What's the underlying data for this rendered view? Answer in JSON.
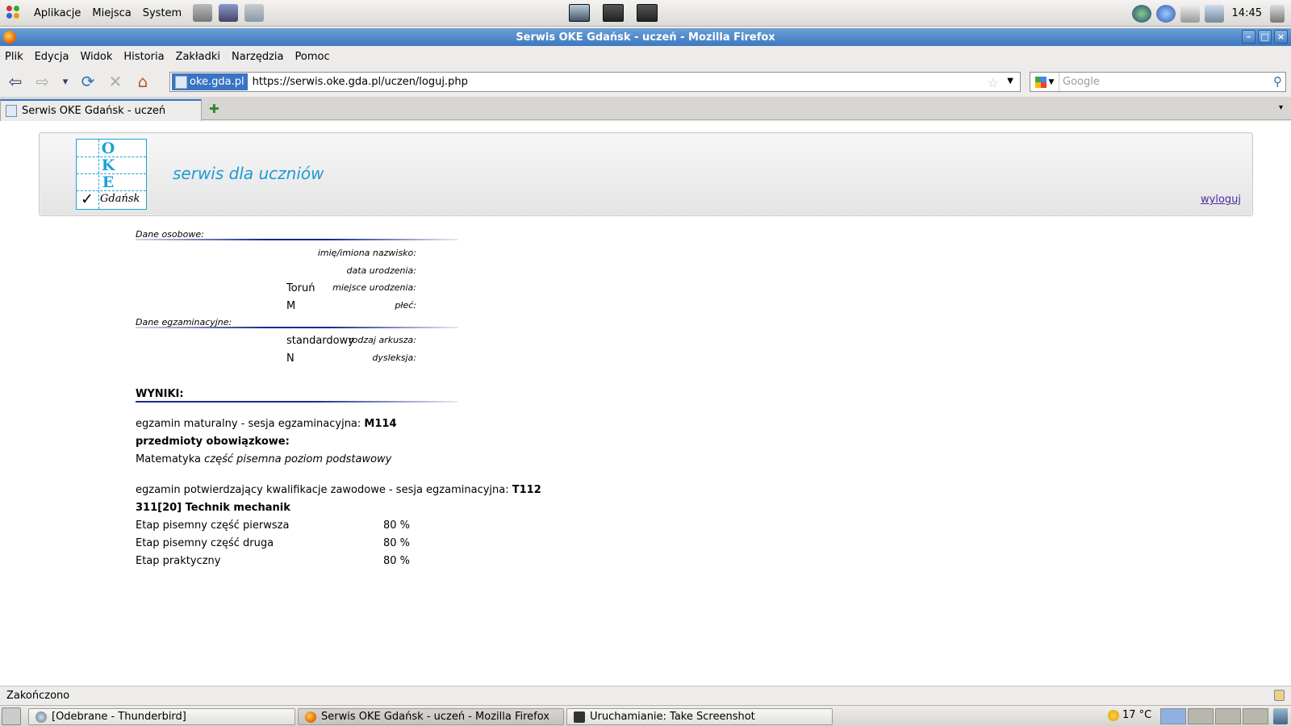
{
  "top_panel": {
    "menus": [
      "Aplikacje",
      "Miejsca",
      "System"
    ],
    "clock": "14:45"
  },
  "window": {
    "title": "Serwis OKE Gdańsk - uczeń - Mozilla Firefox",
    "min": "–",
    "max": "□",
    "close": "×"
  },
  "menubar": [
    "Plik",
    "Edycja",
    "Widok",
    "Historia",
    "Zakładki",
    "Narzędzia",
    "Pomoc"
  ],
  "navbar": {
    "back": "⇦",
    "forward": "⇨",
    "history": "▾",
    "reload": "⟳",
    "stop": "✕",
    "home": "⌂",
    "identity": "oke.gda.pl",
    "url": "https://serwis.oke.gda.pl/uczen/loguj.php",
    "search_placeholder": "Google"
  },
  "tab": {
    "title": "Serwis OKE Gdańsk - uczeń",
    "new_tab": "✚",
    "list": "▾"
  },
  "page": {
    "logo": {
      "letters": [
        "O",
        "K",
        "E"
      ],
      "check": "✓",
      "city": "Gdańsk"
    },
    "site_title": "serwis dla uczniów",
    "logout": "wyloguj",
    "personal": {
      "heading": "Dane osobowe:",
      "fields": [
        {
          "label": "imię/imiona nazwisko:",
          "value": ""
        },
        {
          "label": "data urodzenia:",
          "value": ""
        },
        {
          "label": "miejsce urodzenia:",
          "value": "Toruń"
        },
        {
          "label": "płeć:",
          "value": "M"
        }
      ]
    },
    "exam": {
      "heading": "Dane egzaminacyjne:",
      "fields": [
        {
          "label": "rodzaj arkusza:",
          "value": "standardowy"
        },
        {
          "label": "dysleksja:",
          "value": "N"
        }
      ]
    },
    "results": {
      "heading": "WYNIKI:",
      "matura_session_label": "egzamin maturalny - sesja egzaminacyjna: ",
      "matura_session": "M114",
      "mandatory": "przedmioty obowiązkowe:",
      "subject": "Matematyka",
      "subject_detail": "część pisemna poziom podstawowy",
      "vocational_label": "egzamin potwierdzający kwalifikacje zawodowe - sesja egzaminacyjna: ",
      "vocational_session": "T112",
      "profession": "311[20] Technik mechanik",
      "stages": [
        {
          "name": "Etap pisemny część pierwsza",
          "score": "80 %"
        },
        {
          "name": "Etap pisemny część druga",
          "score": "80 %"
        },
        {
          "name": "Etap praktyczny",
          "score": "80 %"
        }
      ]
    }
  },
  "status": {
    "text": "Zakończono"
  },
  "bottom_panel": {
    "tasks": [
      "[Odebrane - Thunderbird]",
      "Serwis OKE Gdańsk - uczeń - Mozilla Firefox",
      "Uruchamianie: Take Screenshot"
    ],
    "weather": "17 °C"
  },
  "colors": {
    "accent": "#3874c4",
    "title_blue": "#1f9ad3",
    "rule": "#1a2a8c",
    "link": "#4a2ba3"
  }
}
